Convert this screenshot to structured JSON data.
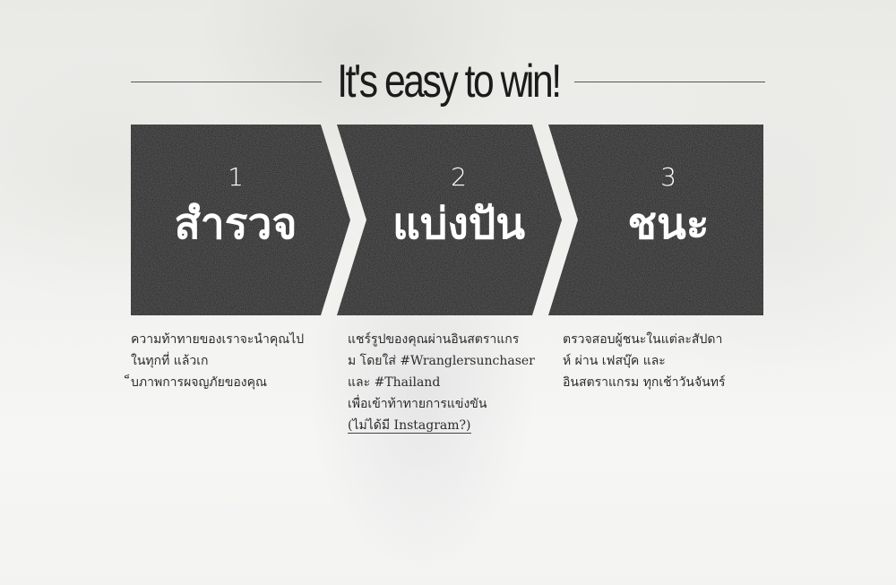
{
  "title": "It's easy to win!",
  "steps": [
    {
      "number": "1",
      "name": "สำรวจ",
      "description": [
        "ความท้าทายของเราจะนำคุณไป",
        "ในทุกที่ แล้วเก",
        "็บภาพการผจญภัยของคุณ"
      ]
    },
    {
      "number": "2",
      "name": "แบ่งปัน",
      "description": [
        "แชร์รูปของคุณผ่านอินสตราแกร",
        "ม โดยใส่ #Wranglersunchaser",
        "และ #Thailand",
        "เพื่อเข้าท้าทายการแข่งขัน"
      ],
      "link_label": "(ไม่ได้มี Instagram?)"
    },
    {
      "number": "3",
      "name": "ชนะ",
      "description": [
        "ตรวจสอบผู้ชนะในแต่ละสัปดา",
        "ห์ ผ่าน เฟสบุ๊ค และ",
        "อินสตราแกรม ทุกเช้าวันจันทร์"
      ]
    }
  ],
  "colors": {
    "panel": "#1c1c1c",
    "text_on_panel": "#ffffff",
    "background": "#eeeeec"
  }
}
